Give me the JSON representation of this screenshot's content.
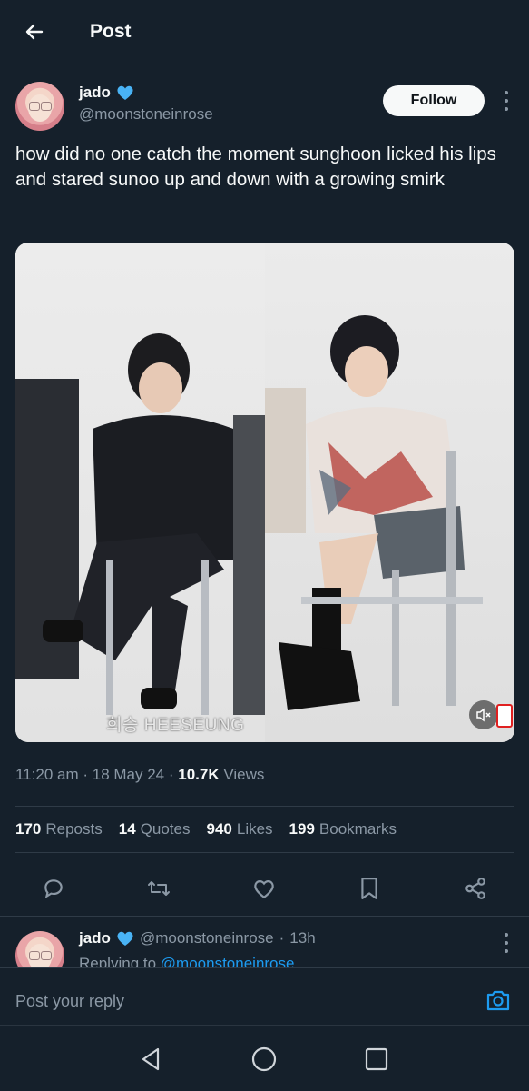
{
  "header": {
    "title": "Post"
  },
  "post": {
    "author_name": "jado",
    "author_handle": "@moonstoneinrose",
    "follow_label": "Follow",
    "text": "how did no one catch the moment sunghoon licked his lips and stared sunoo up and down with a growing smirk",
    "media_caption": "희승 HEESEUNG",
    "time": "11:20 am",
    "date": "18 May 24",
    "views_count": "10.7K",
    "views_label": "Views",
    "stats": [
      {
        "count": "170",
        "label": "Reposts"
      },
      {
        "count": "14",
        "label": "Quotes"
      },
      {
        "count": "940",
        "label": "Likes"
      },
      {
        "count": "199",
        "label": "Bookmarks"
      }
    ]
  },
  "reply": {
    "author_name": "jado",
    "author_handle": "@moonstoneinrose",
    "age": "13h",
    "replying_prefix": "Replying to",
    "replying_to": "@moonstoneinrose"
  },
  "composer": {
    "placeholder": "Post your reply"
  },
  "colors": {
    "background": "#15202b",
    "accent": "#1d9bf0",
    "muted": "#8b98a5",
    "text": "#f7f9f9"
  }
}
